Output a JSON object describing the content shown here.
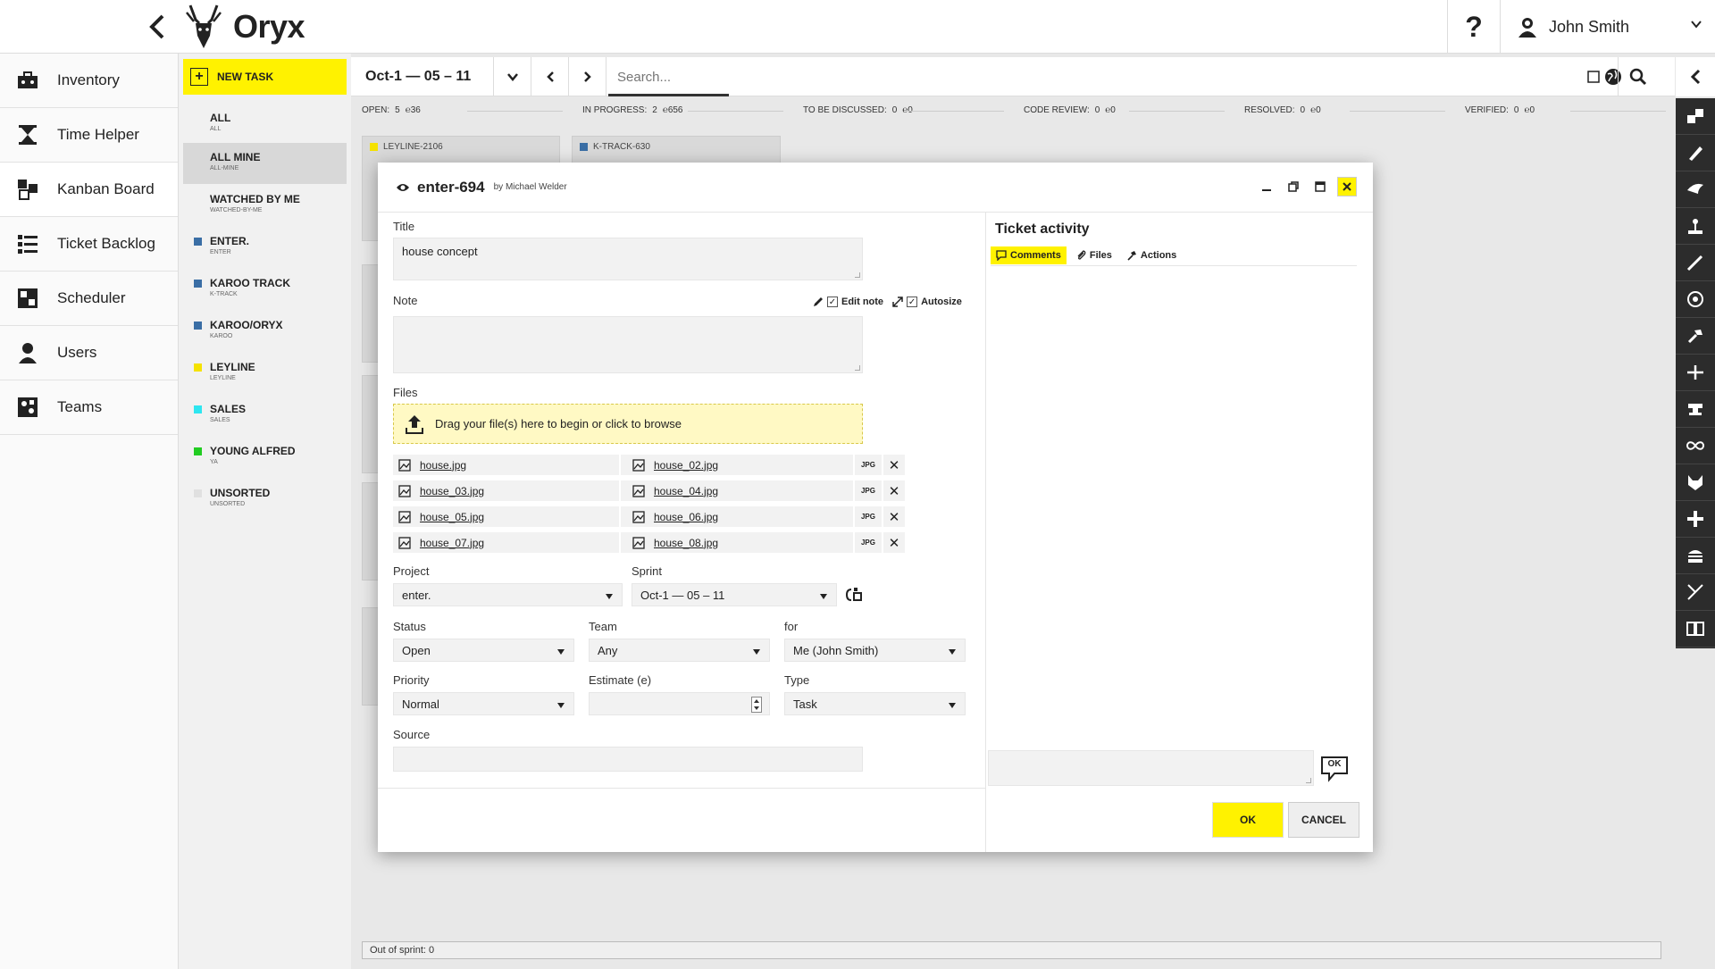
{
  "app": {
    "name": "Oryx"
  },
  "user": {
    "name": "John Smith"
  },
  "sidebar": {
    "items": [
      {
        "label": "Inventory",
        "icon": "toolbox-icon"
      },
      {
        "label": "Time Helper",
        "icon": "hourglass-icon"
      },
      {
        "label": "Kanban Board",
        "icon": "kanban-icon"
      },
      {
        "label": "Ticket Backlog",
        "icon": "list-icon"
      },
      {
        "label": "Scheduler",
        "icon": "calendar-icon"
      },
      {
        "label": "Users",
        "icon": "user-icon"
      },
      {
        "label": "Teams",
        "icon": "teams-icon"
      }
    ],
    "active_index": 2
  },
  "filters": {
    "new_task": "NEW TASK",
    "items": [
      {
        "name": "ALL",
        "sub": "ALL",
        "color": ""
      },
      {
        "name": "ALL MINE",
        "sub": "ALL-MINE",
        "color": ""
      },
      {
        "name": "WATCHED BY ME",
        "sub": "WATCHED-BY-ME",
        "color": ""
      },
      {
        "name": "ENTER.",
        "sub": "ENTER",
        "color": "#3a6ea5"
      },
      {
        "name": "KAROO TRACK",
        "sub": "K-TRACK",
        "color": "#3a6ea5"
      },
      {
        "name": "KAROO/ORYX",
        "sub": "KAROO",
        "color": "#3a6ea5"
      },
      {
        "name": "LEYLINE",
        "sub": "LEYLINE",
        "color": "#f5e200"
      },
      {
        "name": "SALES",
        "sub": "SALES",
        "color": "#2ee6f0"
      },
      {
        "name": "YOUNG ALFRED",
        "sub": "YA",
        "color": "#22cc22"
      },
      {
        "name": "UNSORTED",
        "sub": "UNSORTED",
        "color": "#e0e0e0"
      }
    ]
  },
  "toolbar": {
    "sprint": "Oct-1 — 05 – 11",
    "search_placeholder": "Search..."
  },
  "statuses": [
    {
      "label": "OPEN:",
      "count": "5",
      "est": "℮36"
    },
    {
      "label": "IN PROGRESS:",
      "count": "2",
      "est": "℮656"
    },
    {
      "label": "TO BE DISCUSSED:",
      "count": "0",
      "est": "℮0"
    },
    {
      "label": "CODE REVIEW:",
      "count": "0",
      "est": "℮0"
    },
    {
      "label": "RESOLVED:",
      "count": "0",
      "est": "℮0"
    },
    {
      "label": "VERIFIED:",
      "count": "0",
      "est": "℮0"
    }
  ],
  "bg_cards": {
    "card1": "LEYLINE-2106",
    "card2": "K-TRACK-630"
  },
  "out_of_sprint": "Out of sprint: 0",
  "modal": {
    "ticket_id": "enter-694",
    "by": "by Michael Welder",
    "title_label": "Title",
    "title_value": "house concept",
    "note_label": "Note",
    "edit_note": "Edit note",
    "autosize": "Autosize",
    "files_label": "Files",
    "dropzone": "Drag your file(s) here to begin or click to browse",
    "files": [
      {
        "name": "house.jpg",
        "type": "JPG"
      },
      {
        "name": "house_02.jpg",
        "type": "JPG"
      },
      {
        "name": "house_03.jpg",
        "type": "JPG"
      },
      {
        "name": "house_04.jpg",
        "type": "JPG"
      },
      {
        "name": "house_05.jpg",
        "type": "JPG"
      },
      {
        "name": "house_06.jpg",
        "type": "JPG"
      },
      {
        "name": "house_07.jpg",
        "type": "JPG"
      },
      {
        "name": "house_08.jpg",
        "type": "JPG"
      }
    ],
    "project_label": "Project",
    "project_value": "enter.",
    "sprint_label": "Sprint",
    "sprint_value": "Oct-1 — 05 – 11",
    "status_label": "Status",
    "status_value": "Open",
    "team_label": "Team",
    "team_value": "Any",
    "for_label": "for",
    "for_value": "Me (John Smith)",
    "priority_label": "Priority",
    "priority_value": "Normal",
    "estimate_label": "Estimate (e)",
    "estimate_value": "",
    "type_label": "Type",
    "type_value": "Task",
    "source_label": "Source",
    "source_value": "",
    "activity_title": "Ticket activity",
    "tabs": [
      "Comments",
      "Files",
      "Actions"
    ],
    "comment_ok": "OK",
    "ok": "OK",
    "cancel": "CANCEL"
  }
}
